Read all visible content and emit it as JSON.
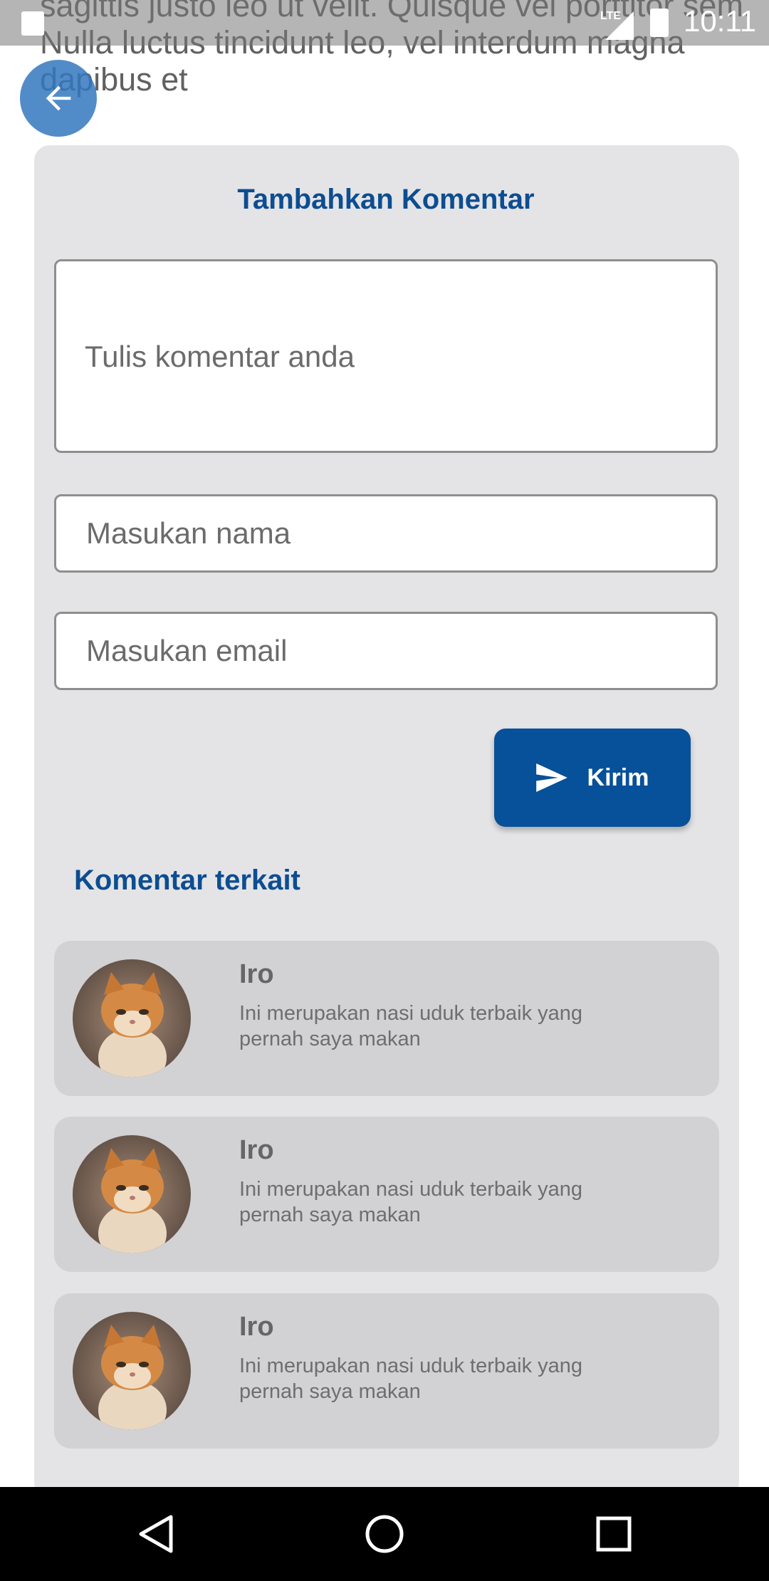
{
  "article": {
    "text": "sagittis justo leo ut velit. Quisque vel porttitor sem. Nulla luctus tincidunt leo, vel interdum magna dapibus et"
  },
  "status_bar": {
    "network": "LTE",
    "time": "10:11"
  },
  "icons": {
    "back": "arrow-back-icon",
    "send": "send-icon",
    "nav_back": "triangle-back-icon",
    "nav_home": "circle-home-icon",
    "nav_recents": "square-recents-icon"
  },
  "comment_form": {
    "title": "Tambahkan Komentar",
    "comment_placeholder": "Tulis komentar anda",
    "name_placeholder": "Masukan nama",
    "email_placeholder": "Masukan email",
    "submit_label": "Kirim"
  },
  "related": {
    "title": "Komentar terkait",
    "comments": [
      {
        "name": "Iro",
        "text": "Ini merupakan nasi uduk terbaik yang pernah saya makan"
      },
      {
        "name": "Iro",
        "text": "Ini merupakan nasi uduk terbaik yang pernah saya makan"
      },
      {
        "name": "Iro",
        "text": "Ini merupakan nasi uduk terbaik yang pernah saya makan"
      }
    ]
  },
  "colors": {
    "primary": "#07509A",
    "heading": "#0D4D91",
    "card_bg": "#E4E4E6",
    "item_bg": "#D2D2D4"
  }
}
